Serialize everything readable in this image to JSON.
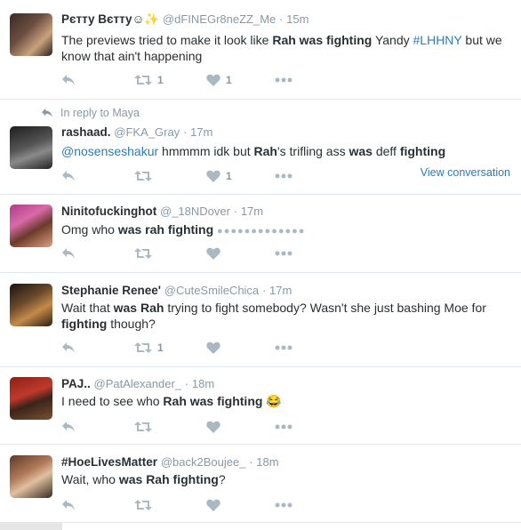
{
  "tweets": [
    {
      "name": "Pєтту Вєтту",
      "emoji": "☺✨",
      "handle": "@dFINEGr8neZZ_Me",
      "time": "15m",
      "text1": "The previews tried to make it look like ",
      "b1": "Rah was fighting",
      "text2": " Yandy ",
      "link": "#LHHNY",
      "text3": " but we know that ain't happening",
      "retweets": "1",
      "likes": "1"
    },
    {
      "in_reply": "In reply to Maya",
      "name": "rashaad.",
      "handle": "@FKA_Gray",
      "time": "17m",
      "mention": "@nosenseshakur",
      "text1": " hmmmm idk but ",
      "b1": "Rah",
      "text2": "'s trifling ass ",
      "b2": "was",
      "text3": " deff ",
      "b3": "fighting",
      "likes": "1",
      "view_conversation": "View conversation"
    },
    {
      "name": "Ninitofuckinghot",
      "handle": "@_18NDover",
      "time": "17m",
      "text1": "Omg who ",
      "b1": "was rah fighting",
      "dots": "●●●●●●●●●●●●●"
    },
    {
      "name": "Stephanie Renee'",
      "handle": "@CuteSmileChica",
      "time": "17m",
      "text1": "Wait that ",
      "b1": "was Rah",
      "text2": " trying to fight somebody? Wasn't she just bashing Moe for ",
      "b2": "fighting",
      "text3": " though?",
      "retweets": "1"
    },
    {
      "name": "PAJ..",
      "handle": "@PatAlexander_",
      "time": "18m",
      "text1": "I need to see who ",
      "b1": "Rah was fighting",
      "emoji": "😂"
    },
    {
      "name": "#HoeLivesMatter",
      "handle": "@back2Boujee_",
      "time": "18m",
      "text1": "Wait, who ",
      "b1": "was Rah fighting",
      "text2": "?"
    }
  ],
  "icons": {
    "reply": "reply-icon",
    "retweet": "retweet-icon",
    "like": "heart-icon",
    "more": "more-icon"
  },
  "colors": {
    "link": "#2b7bb9",
    "muted": "#8899a6",
    "icon": "#aab8c2"
  }
}
